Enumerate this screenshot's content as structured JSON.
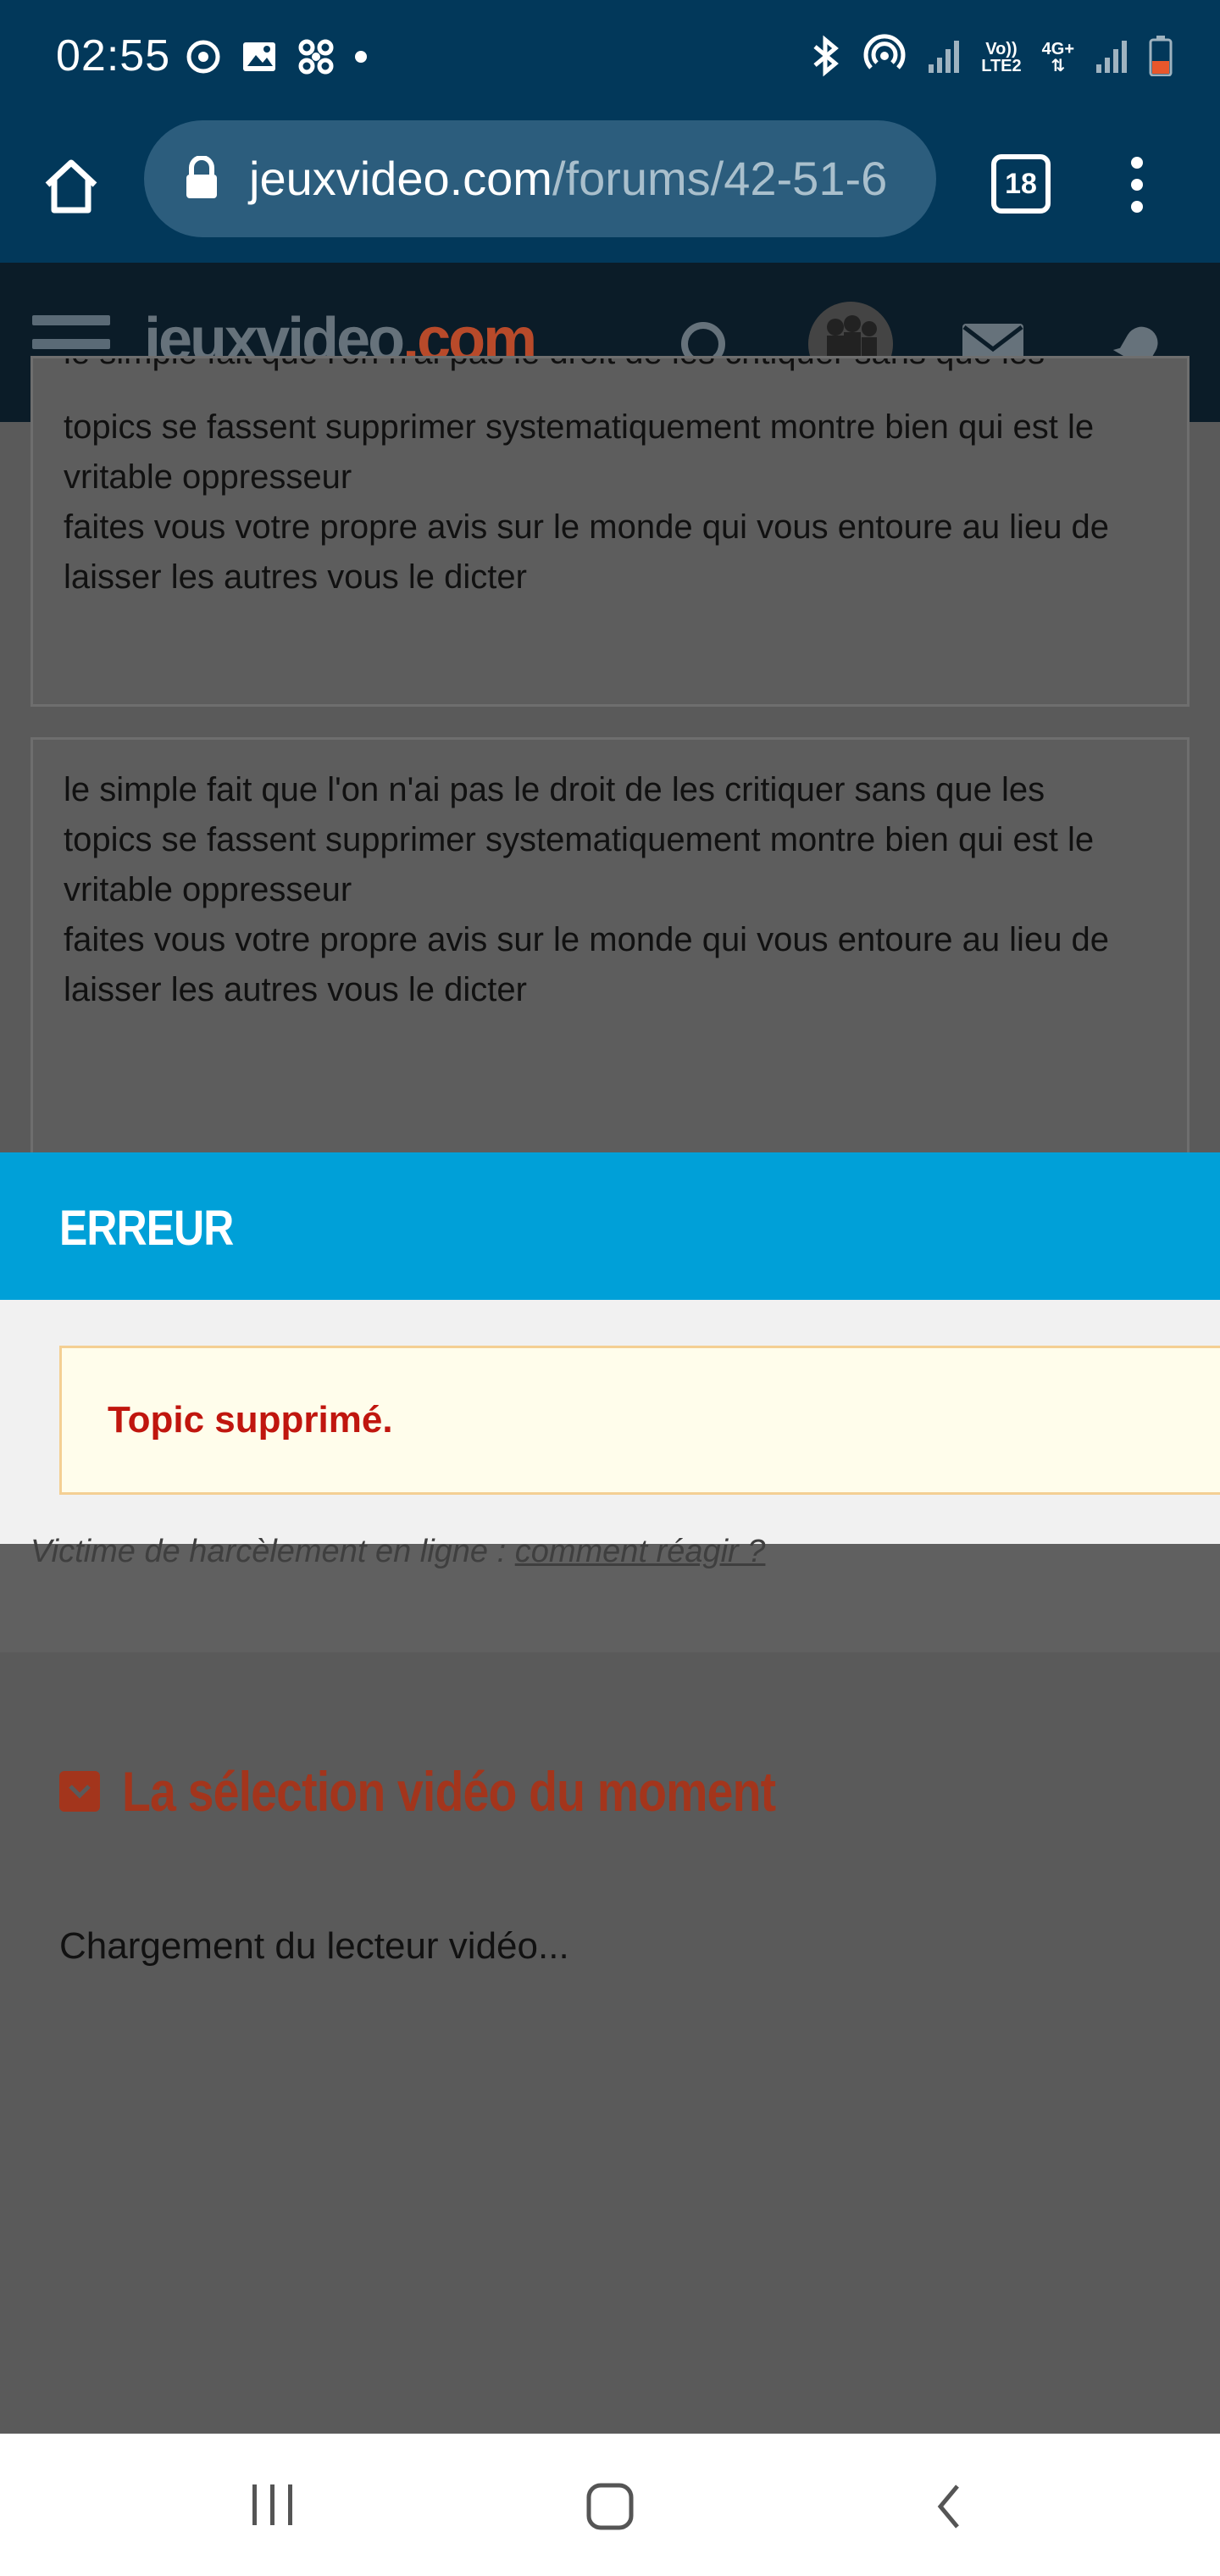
{
  "status_bar": {
    "time": "02:55",
    "left_icons": [
      "sync-icon",
      "image-icon",
      "fan-icon",
      "dot-icon"
    ],
    "right_icons": [
      "bluetooth-icon",
      "hotspot-icon",
      "signal-icon",
      "volte-icon",
      "4g-icon",
      "signal-icon",
      "battery-icon"
    ],
    "volte_label_top": "Vo))",
    "volte_label_bottom": "LTE2",
    "net_label": "4G+"
  },
  "browser": {
    "url_domain": "jeuxvideo.com",
    "url_path": "/forums/42-51-6",
    "tab_count": "18"
  },
  "site_header": {
    "logo_main": "jeuxvideo",
    "logo_tld": ".com",
    "brand_color": "#b84a2a"
  },
  "content": {
    "textarea1_lines": [
      "topics se fassent supprimer systematiquement montre bien qui est le",
      "vritable oppresseur",
      "faites vous votre propre avis sur le monde qui vous entoure au lieu de",
      "laisser les autres vous le dicter"
    ],
    "textarea1_clipped_line": "le simple fait que l'on n'ai pas le droit de les critiquer sans que les",
    "textarea2_lines": [
      "le simple fait que l'on n'ai pas le droit de les critiquer sans que les",
      "topics se fassent supprimer systematiquement montre bien qui est le",
      "vritable oppresseur",
      "faites vous votre propre avis sur le monde qui vous entoure au lieu de",
      "laisser les autres vous le dicter"
    ]
  },
  "modal": {
    "title": "ERREUR",
    "message": "Topic supprimé.",
    "header_color": "#00a0d8",
    "message_color": "#c0160e"
  },
  "below": {
    "faded_text": "Victime de harcèlement en ligne : ",
    "faded_link": "comment réagir ?",
    "section_title": "La sélection vidéo du moment",
    "loading": "Chargement du lecteur vidéo..."
  },
  "nav": {
    "buttons": [
      "recent-apps",
      "home",
      "back"
    ]
  }
}
